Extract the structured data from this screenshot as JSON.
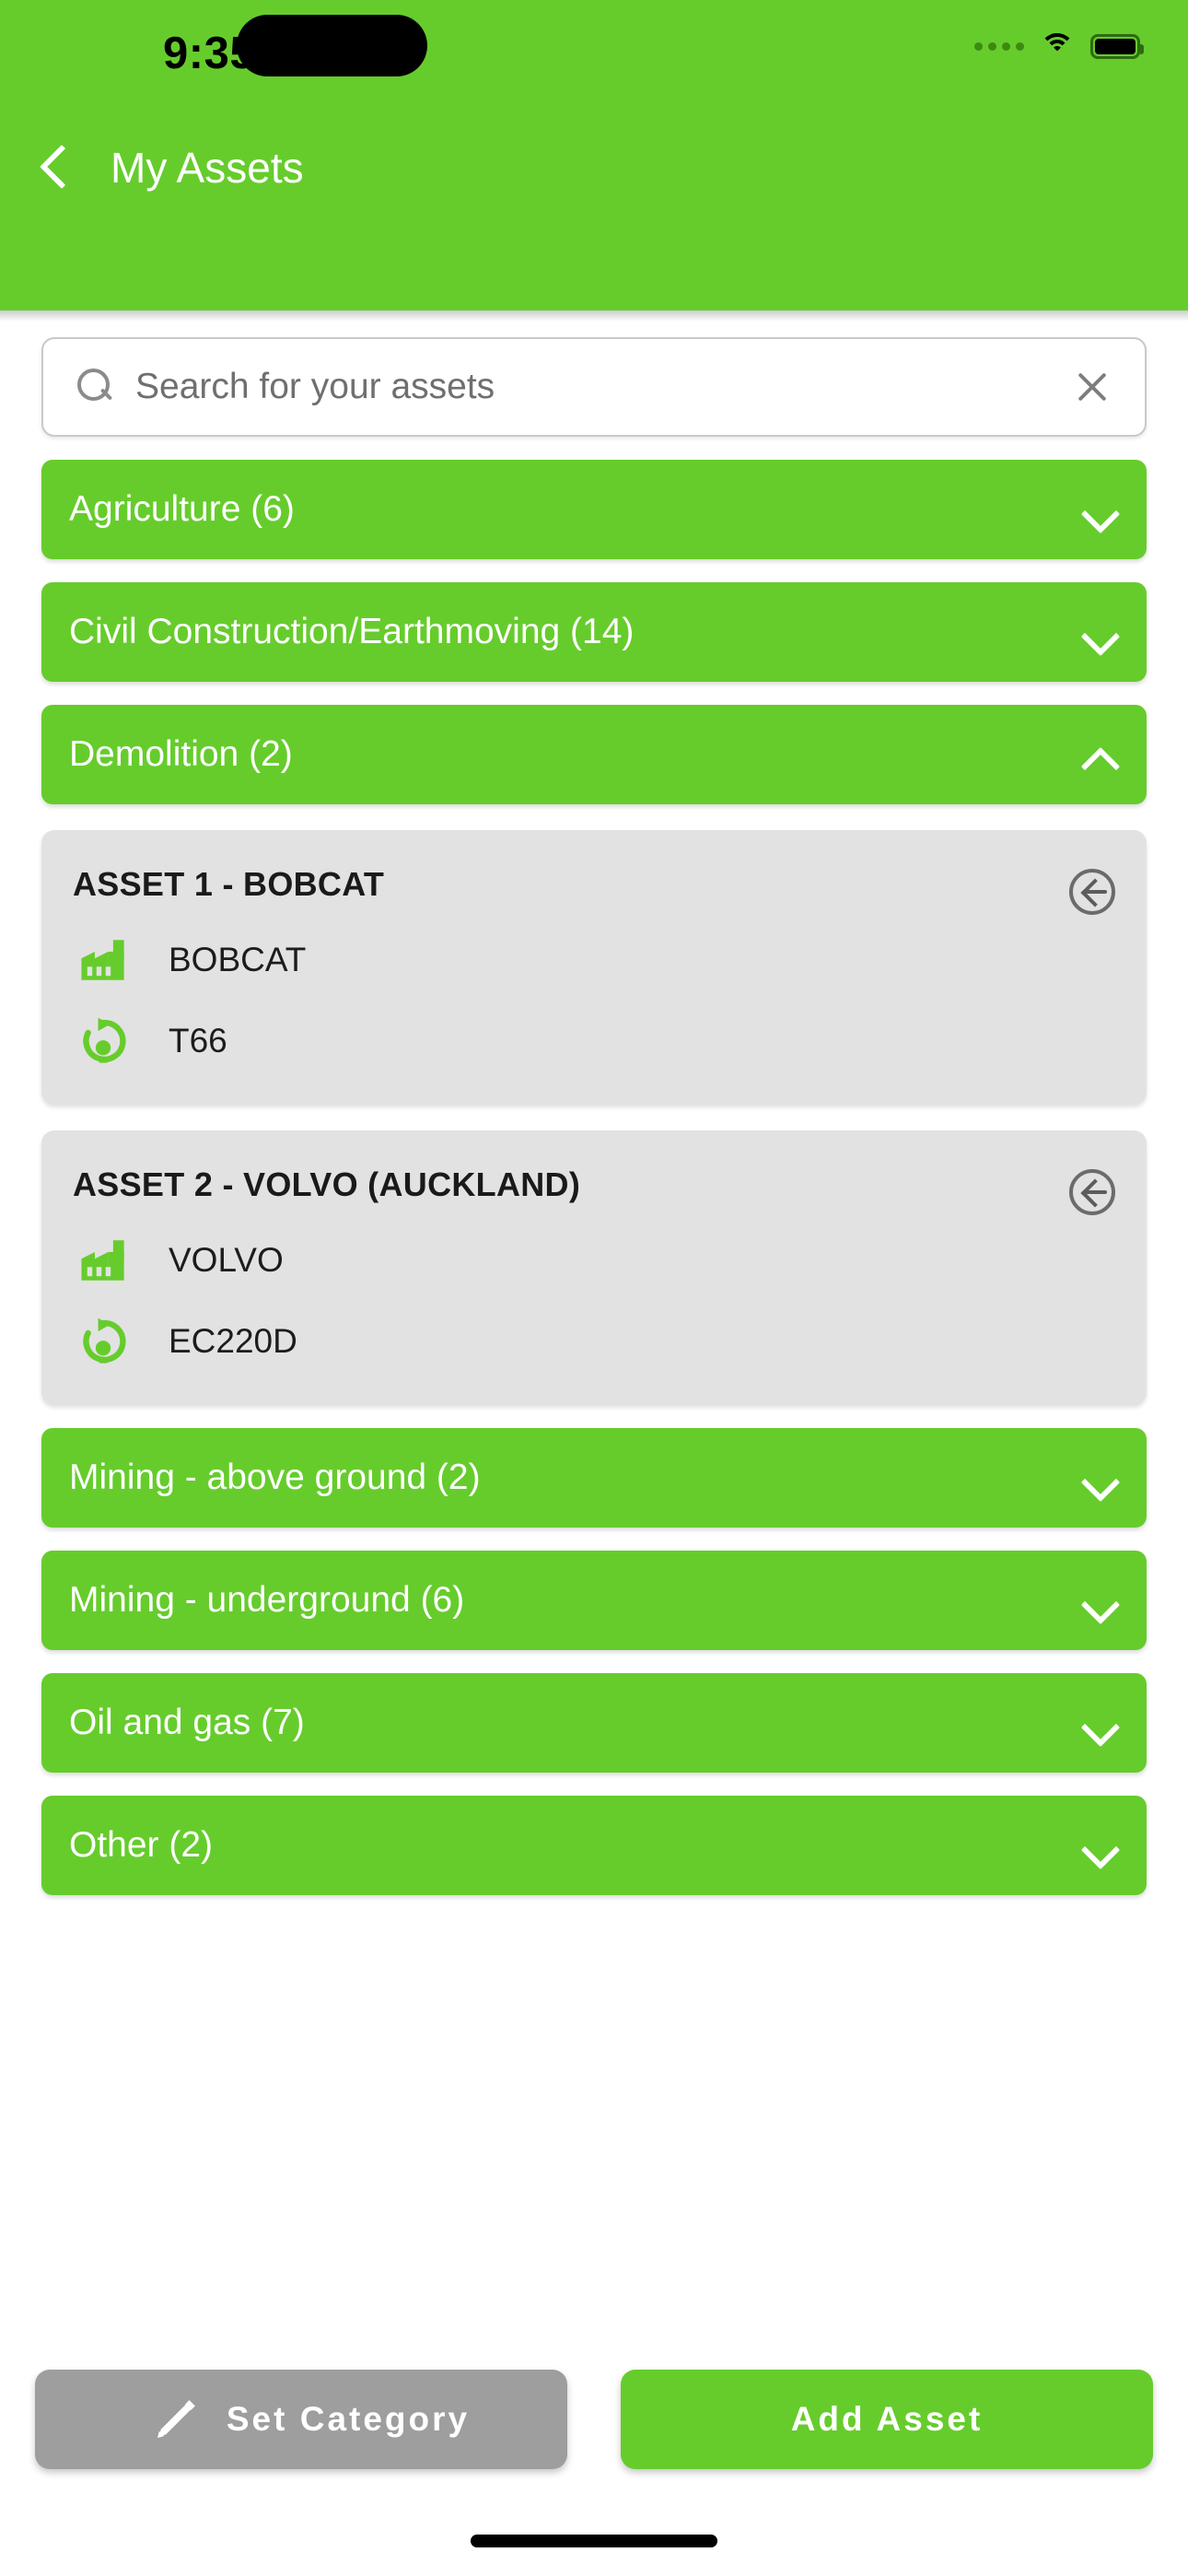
{
  "status_bar": {
    "time": "9:35",
    "icons": [
      "cellular-dots-icon",
      "wifi-icon",
      "battery-icon"
    ]
  },
  "header": {
    "back_icon": "chevron-left-icon",
    "title": "My Assets"
  },
  "search": {
    "icon": "search-icon",
    "placeholder": "Search for your assets",
    "value": "",
    "clear_icon": "close-icon"
  },
  "colors": {
    "brand_green": "#66CC2C",
    "card_gray": "#e2e2e2",
    "fab_gray": "#9e9e9e",
    "text_dark": "#1a1a1a"
  },
  "categories": [
    {
      "label": "Agriculture (6)",
      "count": 6,
      "expanded": false,
      "chevron": "chevron-down-icon"
    },
    {
      "label": "Civil Construction/Earthmoving (14)",
      "count": 14,
      "expanded": false,
      "chevron": "chevron-down-icon"
    },
    {
      "label": "Demolition (2)",
      "count": 2,
      "expanded": true,
      "chevron": "chevron-up-icon"
    },
    {
      "label": "Mining - above ground (2)",
      "count": 2,
      "expanded": false,
      "chevron": "chevron-down-icon"
    },
    {
      "label": "Mining - underground (6)",
      "count": 6,
      "expanded": false,
      "chevron": "chevron-down-icon"
    },
    {
      "label": "Oil and gas (7)",
      "count": 7,
      "expanded": false,
      "chevron": "chevron-down-icon"
    },
    {
      "label": "Other (2)",
      "count": 2,
      "expanded": false,
      "chevron": "chevron-down-icon"
    }
  ],
  "assets": [
    {
      "title": "ASSET 1 - BOBCAT",
      "make": "BOBCAT",
      "model": "T66",
      "make_icon": "factory-icon",
      "model_icon": "refresh-arrow-icon",
      "action_icon": "circle-arrow-left-icon"
    },
    {
      "title": "ASSET 2 - VOLVO (AUCKLAND)",
      "make": "VOLVO",
      "model": "EC220D",
      "make_icon": "factory-icon",
      "model_icon": "refresh-arrow-icon",
      "action_icon": "circle-arrow-left-icon"
    }
  ],
  "actions": {
    "set_category": {
      "label": "Set Category",
      "icon": "pencil-icon"
    },
    "add_asset": {
      "label": "Add Asset"
    }
  }
}
